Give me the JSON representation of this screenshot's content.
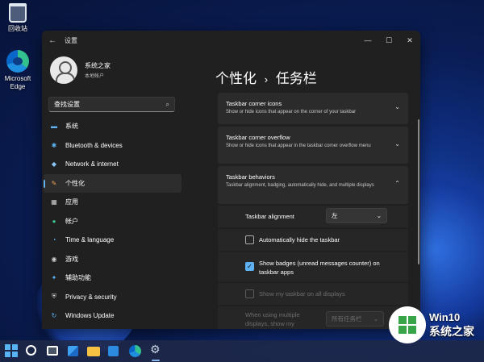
{
  "desktop": {
    "icons": [
      {
        "label": "回收站",
        "icon": "recycle-bin-icon"
      },
      {
        "label": "Microsoft Edge",
        "icon": "edge-icon"
      }
    ]
  },
  "window": {
    "title": "设置",
    "controls": {
      "minimize": "—",
      "maximize": "☐",
      "close": "✕"
    },
    "back": "←"
  },
  "profile": {
    "name": "系统之家",
    "account": "本地帐户"
  },
  "search": {
    "placeholder": "查找设置",
    "icon": "⌕"
  },
  "nav": [
    {
      "label": "系统",
      "icon": "▬",
      "color": "#5fb2f2"
    },
    {
      "label": "Bluetooth & devices",
      "icon": "✱",
      "color": "#5fb2f2"
    },
    {
      "label": "Network & internet",
      "icon": "◆",
      "color": "#8ac5f5"
    },
    {
      "label": "个性化",
      "icon": "✎",
      "color": "#f0a35a",
      "active": true
    },
    {
      "label": "应用",
      "icon": "▦",
      "color": "#cfcfcf"
    },
    {
      "label": "帐户",
      "icon": "●",
      "color": "#3fc28a"
    },
    {
      "label": "Time & language",
      "icon": "◔",
      "color": "#5fb2f2"
    },
    {
      "label": "游戏",
      "icon": "◉",
      "color": "#cfcfcf"
    },
    {
      "label": "辅助功能",
      "icon": "✦",
      "color": "#5fb2f2"
    },
    {
      "label": "Privacy & security",
      "icon": "⛨",
      "color": "#cfcfcf"
    },
    {
      "label": "Windows Update",
      "icon": "↻",
      "color": "#5fb2f2"
    }
  ],
  "breadcrumb": {
    "parent": "个性化",
    "sep": "›",
    "current": "任务栏"
  },
  "cards": [
    {
      "title": "Taskbar corner icons",
      "subtitle": "Show or hide icons that appear on the corner of your taskbar",
      "chevron": "⌄"
    },
    {
      "title": "Taskbar corner overflow",
      "subtitle": "Show or hide icons that appear in the taskbar corner overflow menu",
      "chevron": "⌄"
    },
    {
      "title": "Taskbar behaviors",
      "subtitle": "Taskbar alignment, badging, automatically hide, and multiple displays",
      "chevron": "⌃"
    }
  ],
  "behaviors": {
    "alignment_label": "Taskbar alignment",
    "alignment_value": "左",
    "auto_hide": "Automatically hide the taskbar",
    "badges": "Show badges (unread messages counter) on taskbar apps",
    "all_displays": "Show my taskbar on all displays",
    "multi_label": "When using multiple displays, show my",
    "multi_value": "所有任务栏",
    "dropdown_icon": "⌄",
    "check": "✓"
  },
  "taskbar": {
    "settings_glyph": "⚙"
  },
  "watermark": {
    "line1": "Win10",
    "line2": "系统之家"
  }
}
